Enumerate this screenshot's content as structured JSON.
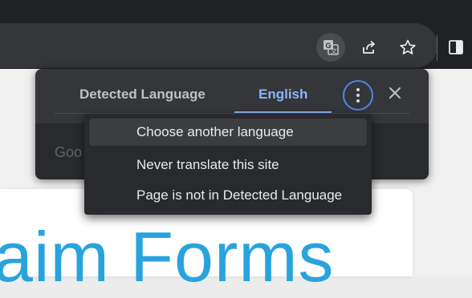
{
  "toolbar": {
    "icons": [
      "translate-icon",
      "share-icon",
      "bookmark-star-icon",
      "side-panel-icon"
    ]
  },
  "translate_bubble": {
    "tabs": [
      {
        "label": "Detected Language"
      },
      {
        "label": "English",
        "selected": true
      }
    ],
    "footer_text": "Goo"
  },
  "menu": {
    "items": [
      {
        "label": "Choose another language"
      },
      {
        "label": "Never translate this site"
      },
      {
        "label": "Page is not in Detected Language"
      }
    ]
  },
  "page": {
    "heading": "aim Forms"
  },
  "colors": {
    "accent": "#8ab4f8",
    "focus_ring": "#4f86e8",
    "heading": "#29a3dd"
  }
}
